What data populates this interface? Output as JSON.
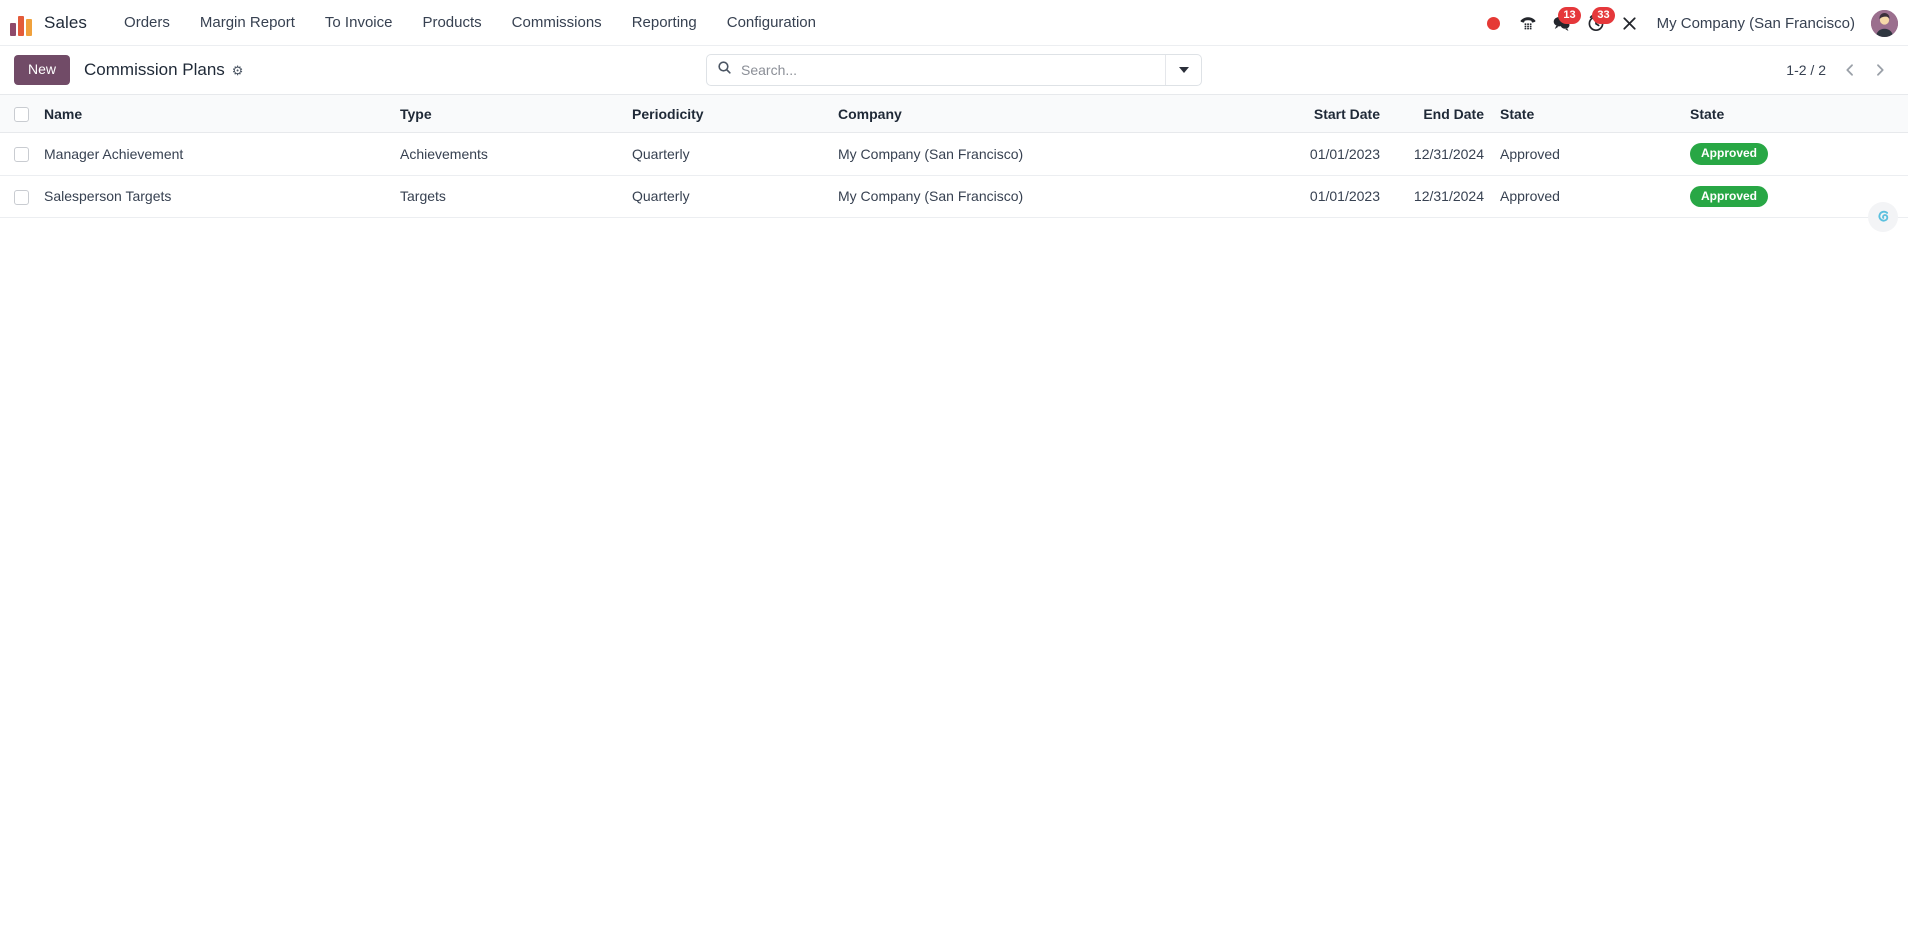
{
  "navbar": {
    "brand": "sales-logo",
    "app_name": "Sales",
    "menu_items": [
      {
        "label": "Orders",
        "name": "menu-orders"
      },
      {
        "label": "Margin Report",
        "name": "menu-margin-report"
      },
      {
        "label": "To Invoice",
        "name": "menu-to-invoice"
      },
      {
        "label": "Products",
        "name": "menu-products"
      },
      {
        "label": "Commissions",
        "name": "menu-commissions"
      },
      {
        "label": "Reporting",
        "name": "menu-reporting"
      },
      {
        "label": "Configuration",
        "name": "menu-configuration"
      }
    ],
    "systray": {
      "recording_dot": "record-dot-icon",
      "phone_icon": "phone-dialpad-icon",
      "messages_icon": "messages-icon",
      "messages_count": "13",
      "activities_icon": "activities-clock-icon",
      "activities_count": "33",
      "shortcuts_icon": "keyboard-shortcut-icon",
      "company": "My Company (San Francisco)",
      "avatar": "user-avatar"
    }
  },
  "control_panel": {
    "new_label": "New",
    "breadcrumb": "Commission Plans",
    "settings_icon": "gear-icon",
    "search": {
      "placeholder": "Search...",
      "value": "",
      "icon": "search-icon",
      "toggle_icon": "chevron-down-icon"
    },
    "pager": {
      "range": "1-2 / 2",
      "previous_icon": "chevron-left-icon",
      "next_icon": "chevron-right-icon"
    }
  },
  "list": {
    "columns": [
      {
        "label": "Name",
        "key": "name"
      },
      {
        "label": "Type",
        "key": "type"
      },
      {
        "label": "Periodicity",
        "key": "periodicity"
      },
      {
        "label": "Company",
        "key": "company"
      },
      {
        "label": "Start Date",
        "key": "start_date"
      },
      {
        "label": "End Date",
        "key": "end_date"
      },
      {
        "label": "State",
        "key": "state"
      },
      {
        "label": "State",
        "key": "state_badge"
      }
    ],
    "rows": [
      {
        "name": "Manager Achievement",
        "type": "Achievements",
        "periodicity": "Quarterly",
        "company": "My Company (San Francisco)",
        "start_date": "01/01/2023",
        "end_date": "12/31/2024",
        "state": "Approved",
        "state_badge": "Approved"
      },
      {
        "name": "Salesperson Targets",
        "type": "Targets",
        "periodicity": "Quarterly",
        "company": "My Company (San Francisco)",
        "start_date": "01/01/2023",
        "end_date": "12/31/2024",
        "state": "Approved",
        "state_badge": "Approved"
      }
    ]
  },
  "help_bubble": {
    "icon": "odoo-help-bubble-icon"
  },
  "colors": {
    "primary": "#714B67",
    "badge_success": "#28a745",
    "alert_red": "#E5383B",
    "header_bg": "#F9FAFB",
    "text": "#374151"
  }
}
